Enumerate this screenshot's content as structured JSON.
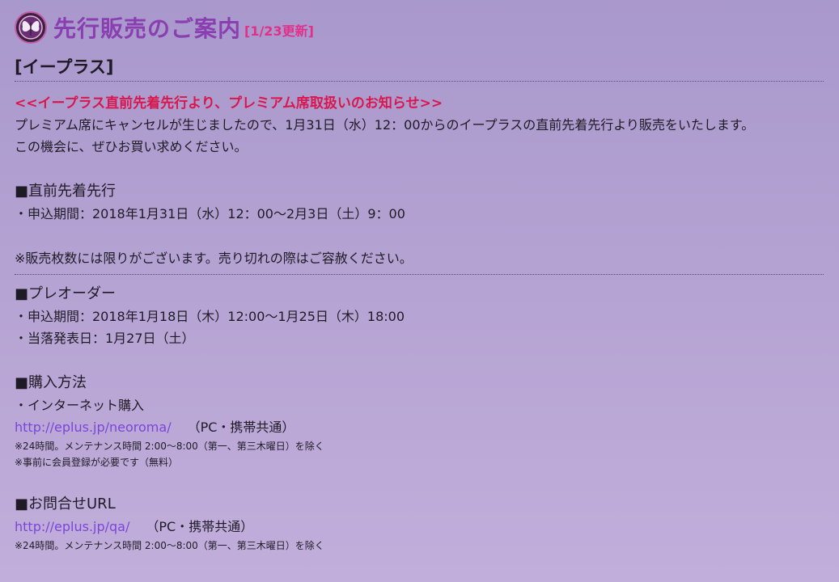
{
  "header": {
    "title": "先行販売のご案内",
    "updated": "[1/23更新]"
  },
  "section": {
    "name": "[イープラス]"
  },
  "notice": {
    "headline": "<<イープラス直前先着先行より、プレミアム席取扱いのお知らせ>>",
    "line1": "プレミアム席にキャンセルが生じましたので、1月31日（水）12：00からのイープラスの直前先着先行より販売をいたします。",
    "line2": "この機会に、ぜひお買い求めください。"
  },
  "direct_presale": {
    "heading": "■直前先着先行",
    "period": "・申込期間：2018年1月31日（水）12：00〜2月3日（土）9：00",
    "note": "※販売枚数には限りがございます。売り切れの際はご容赦ください。"
  },
  "preorder": {
    "heading": "■プレオーダー",
    "period": "・申込期間：2018年1月18日（木）12:00〜1月25日（木）18:00",
    "announce": "・当落発表日：1月27日（土）"
  },
  "purchase": {
    "heading": "■購入方法",
    "method": "・インターネット購入",
    "url": "http://eplus.jp/neoroma/",
    "url_note": "（PC・携帯共通）",
    "small1": "※24時間。メンテナンス時間 2:00〜8:00（第一、第三木曜日）を除く",
    "small2": "※事前に会員登録が必要です（無料）"
  },
  "contact": {
    "heading": "■お問合せURL",
    "url": "http://eplus.jp/qa/",
    "url_note": "（PC・携帯共通）",
    "small1": "※24時間。メンテナンス時間 2:00〜8:00（第一、第三木曜日）を除く"
  },
  "colors": {
    "title": "#8a3fb0",
    "updated": "#e0308a",
    "notice": "#d8174f",
    "link": "#7a45d8"
  },
  "icons": {
    "emblem": "butterfly-gear-emblem-icon"
  }
}
